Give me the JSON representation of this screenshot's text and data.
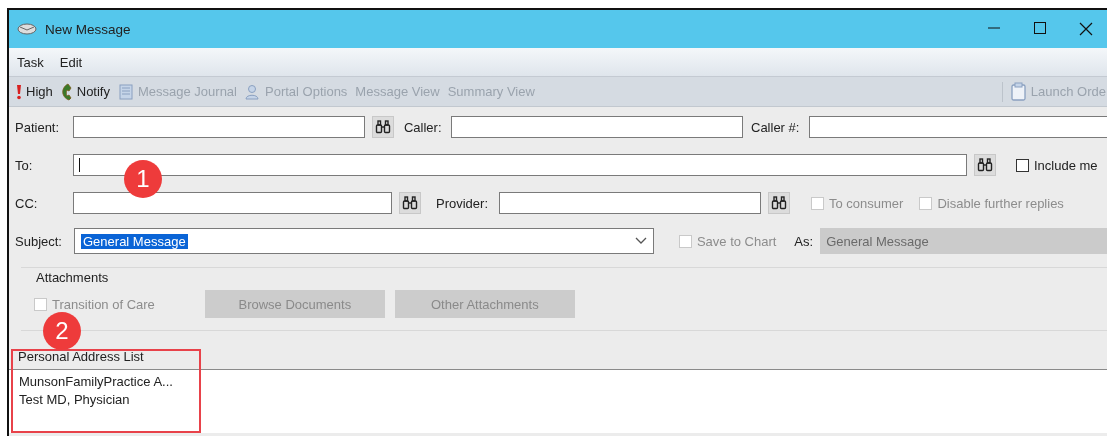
{
  "window": {
    "title": "New Message"
  },
  "menu": [
    "Task",
    "Edit"
  ],
  "toolbar": [
    {
      "label": "High",
      "disabled": false
    },
    {
      "label": "Notify",
      "disabled": false
    },
    {
      "label": "Message Journal",
      "disabled": true
    },
    {
      "label": "Portal Options",
      "disabled": true
    },
    {
      "label": "Message View",
      "disabled": true
    },
    {
      "label": "Summary View",
      "disabled": true
    },
    {
      "label": "Launch Orde",
      "disabled": true
    }
  ],
  "form": {
    "patient": {
      "label": "Patient:"
    },
    "caller": {
      "label": "Caller:"
    },
    "caller_number": {
      "label": "Caller #:"
    },
    "to": {
      "label": "To:"
    },
    "include_me": {
      "label": "Include me",
      "checked": false,
      "disabled": false
    },
    "cc": {
      "label": "CC:"
    },
    "provider": {
      "label": "Provider:"
    },
    "to_consumer": {
      "label": "To consumer",
      "checked": false,
      "disabled": true
    },
    "disable_replies": {
      "label": "Disable further replies",
      "checked": false,
      "disabled": true
    },
    "subject": {
      "label": "Subject:",
      "value": "General Message"
    },
    "save_to_chart": {
      "label": "Save to Chart",
      "checked": false,
      "disabled": true
    },
    "as": {
      "label": "As:",
      "value": "General Message",
      "disabled": true
    }
  },
  "attachments": {
    "title": "Attachments",
    "transition_of_care": {
      "label": "Transition of Care",
      "checked": false,
      "disabled": true
    },
    "buttons": [
      {
        "label": "Browse Documents",
        "disabled": true
      },
      {
        "label": "Other Attachments",
        "disabled": true
      }
    ]
  },
  "personal_address_list": {
    "title": "Personal Address List",
    "items": [
      "MunsonFamilyPractice A...",
      "Test MD, Physician"
    ]
  },
  "callouts": [
    "1",
    "2"
  ]
}
